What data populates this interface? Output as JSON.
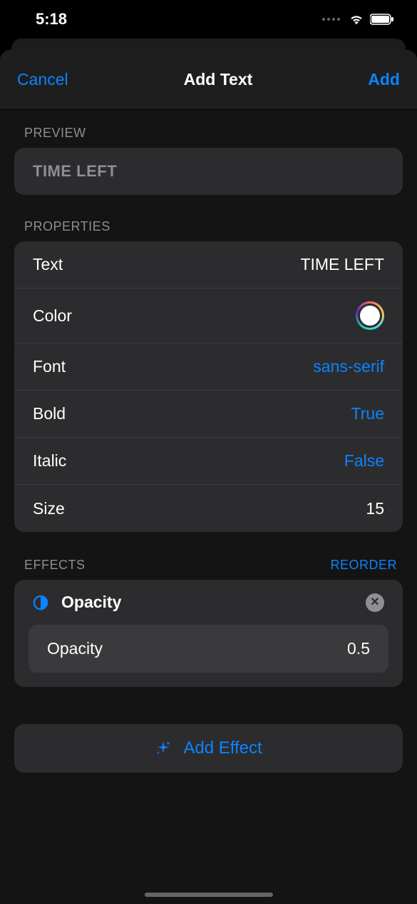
{
  "status": {
    "time": "5:18"
  },
  "nav": {
    "cancel": "Cancel",
    "title": "Add Text",
    "add": "Add"
  },
  "sections": {
    "preview": "PREVIEW",
    "properties": "PROPERTIES",
    "effects": "EFFECTS",
    "reorder": "REORDER"
  },
  "preview": {
    "text": "TIME LEFT"
  },
  "properties": {
    "text": {
      "label": "Text",
      "value": "TIME LEFT"
    },
    "color": {
      "label": "Color",
      "value": "#ffffff"
    },
    "font": {
      "label": "Font",
      "value": "sans-serif"
    },
    "bold": {
      "label": "Bold",
      "value": "True"
    },
    "italic": {
      "label": "Italic",
      "value": "False"
    },
    "size": {
      "label": "Size",
      "value": "15"
    }
  },
  "effects": [
    {
      "title": "Opacity",
      "param_label": "Opacity",
      "param_value": "0.5"
    }
  ],
  "addEffect": "Add Effect"
}
